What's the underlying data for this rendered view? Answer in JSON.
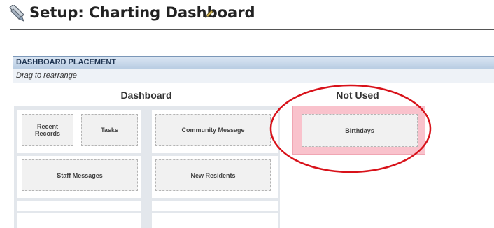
{
  "header": {
    "title": "Setup: Charting Dashboard",
    "icon": "setup-icon",
    "edit_icon": "pencil-icon"
  },
  "section": {
    "title": "DASHBOARD PLACEMENT",
    "subtitle": "Drag to rearrange"
  },
  "columns": {
    "dashboard_title": "Dashboard",
    "not_used_title": "Not Used"
  },
  "dashboard_tiles": {
    "recent_records": "Recent Records",
    "tasks": "Tasks",
    "community_message": "Community Message",
    "staff_messages": "Staff Messages",
    "new_residents": "New Residents"
  },
  "not_used_tiles": {
    "birthdays": "Birthdays"
  },
  "colors": {
    "section_border": "#7b97b8",
    "unused_highlight": "#f9c2cc",
    "annotation_circle": "#d8121a"
  }
}
